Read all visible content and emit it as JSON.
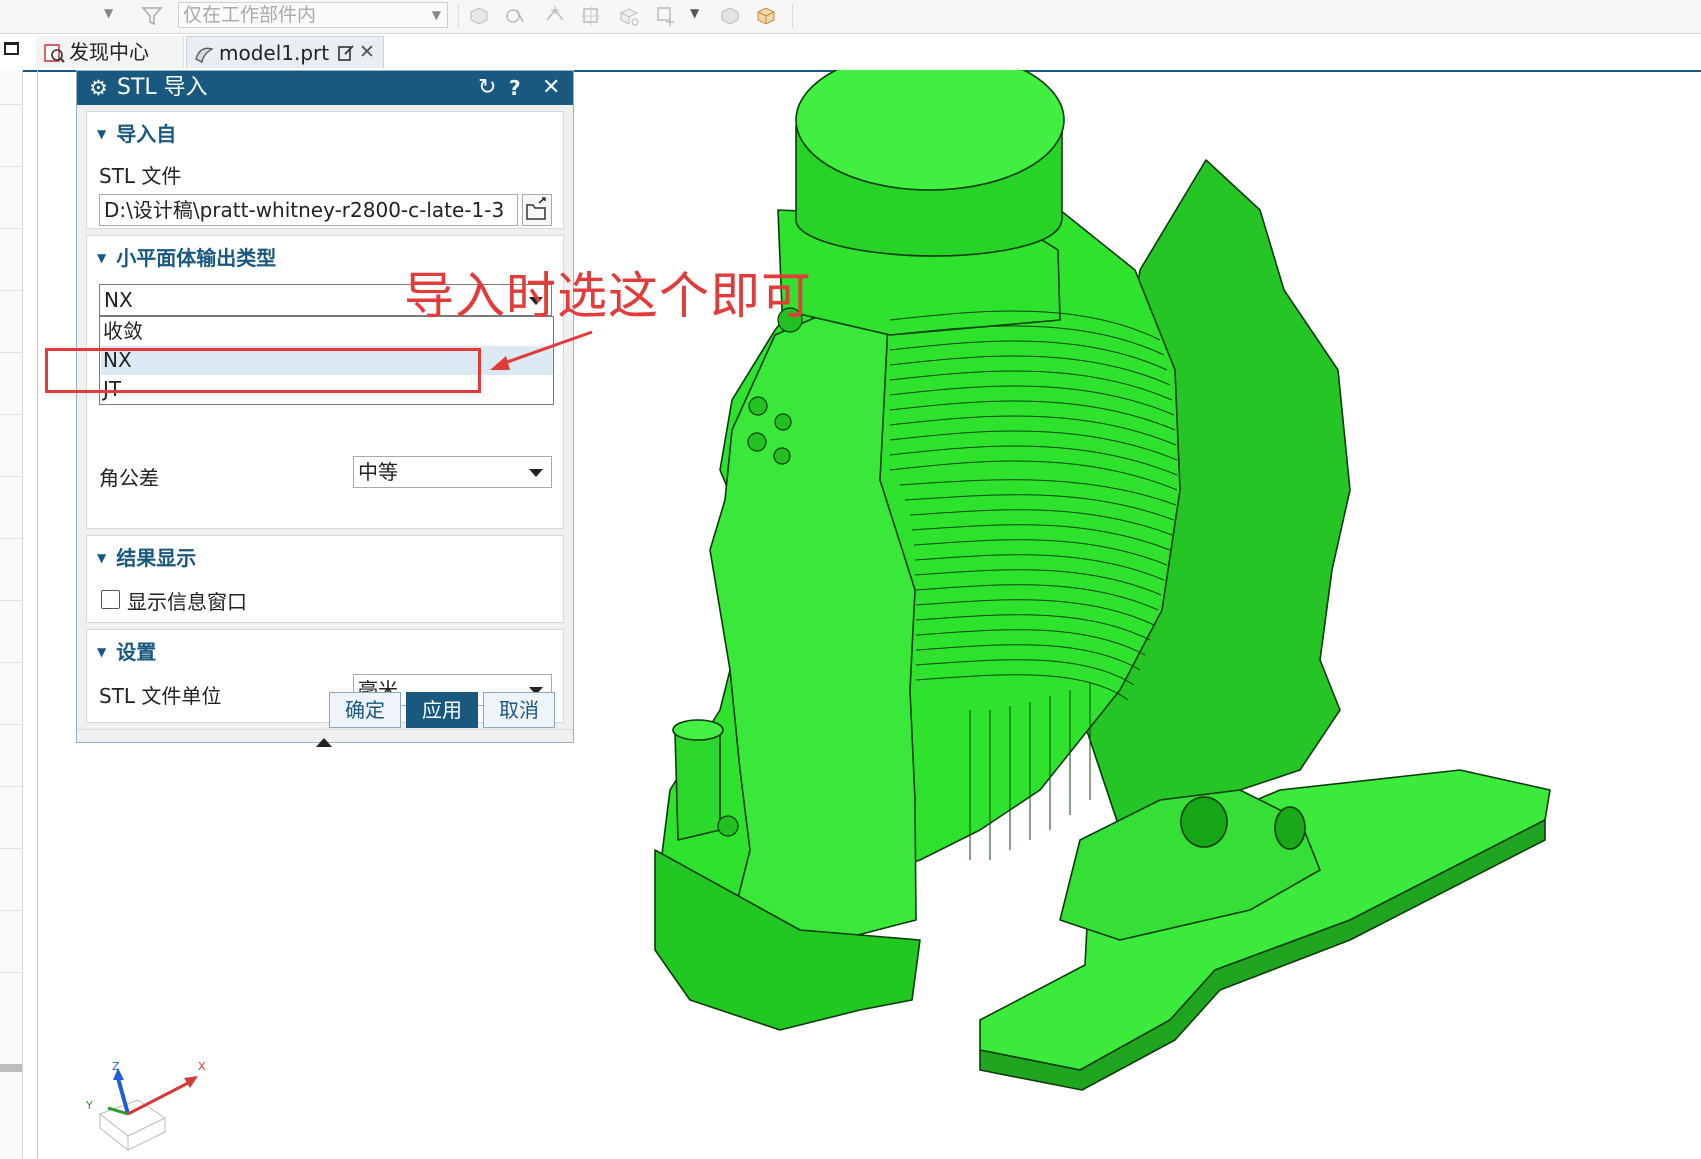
{
  "toolbar": {
    "filter_placeholder": "仅在工作部件内"
  },
  "tabs": [
    {
      "label": "发现中心"
    },
    {
      "label": "model1.prt"
    }
  ],
  "dialog": {
    "title": "STL 导入",
    "import_from": {
      "header": "导入自",
      "file_label": "STL 文件",
      "file_path": "D:\\设计稿\\pratt-whitney-r2800-c-late-1-3"
    },
    "facet_output": {
      "header": "小平面体输出类型",
      "selected": "NX",
      "options": [
        "收敛",
        "NX",
        "JT"
      ],
      "highlighted_index": 1,
      "angle_tolerance_label": "角公差",
      "angle_tolerance_value": "中等"
    },
    "result_display": {
      "header": "结果显示",
      "show_info_label": "显示信息窗口",
      "show_info_checked": false
    },
    "settings": {
      "header": "设置",
      "unit_label": "STL 文件单位",
      "unit_value": "毫米"
    },
    "buttons": {
      "ok": "确定",
      "apply": "应用",
      "cancel": "取消"
    }
  },
  "annotation": {
    "text": "导入时选这个即可",
    "color": "#e33a3a"
  },
  "triad": {
    "x_label": "X",
    "y_label": "Y",
    "z_label": "Z"
  },
  "colors": {
    "accent": "#19587f",
    "model": "#2fe02f"
  }
}
